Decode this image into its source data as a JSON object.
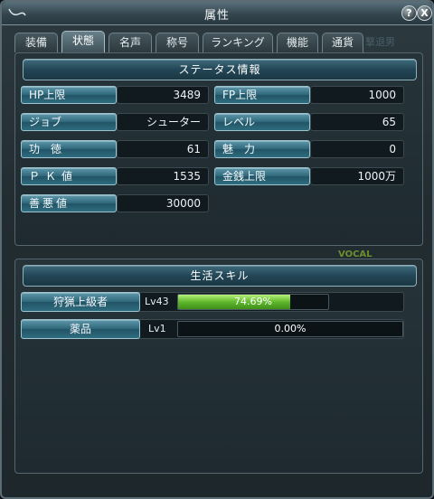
{
  "window": {
    "title": "属性",
    "help_label": "?",
    "close_label": "X"
  },
  "tabs": [
    {
      "label": "装備",
      "active": false
    },
    {
      "label": "状態",
      "active": true
    },
    {
      "label": "名声",
      "active": false
    },
    {
      "label": "称号",
      "active": false
    },
    {
      "label": "ランキング",
      "active": false
    },
    {
      "label": "機能",
      "active": false
    },
    {
      "label": "通貨",
      "active": false
    }
  ],
  "background_text": "撃退男",
  "status": {
    "header": "ステータス情報",
    "hp_label": "HP上限",
    "hp_value": "3489",
    "fp_label": "FP上限",
    "fp_value": "1000",
    "job_label": "ジョブ",
    "job_value": "シューター",
    "level_label": "レベル",
    "level_value": "65",
    "merit_label": "功徳",
    "merit_value": "61",
    "charm_label": "魅力",
    "charm_value": "0",
    "pk_label": "ＰＫ値",
    "pk_value": "1535",
    "money_label": "金銭上限",
    "money_value": "1000万",
    "karma_label": "善悪値",
    "karma_value": "30000"
  },
  "life": {
    "header": "生活スキル",
    "vocal": "VOCAL",
    "skills": [
      {
        "name": "狩猟上級者",
        "level": "Lv43",
        "progress_text": "74.69%",
        "progress": 74.69
      },
      {
        "name": "薬品",
        "level": "Lv1",
        "progress_text": "0.00%",
        "progress": 0
      }
    ]
  }
}
